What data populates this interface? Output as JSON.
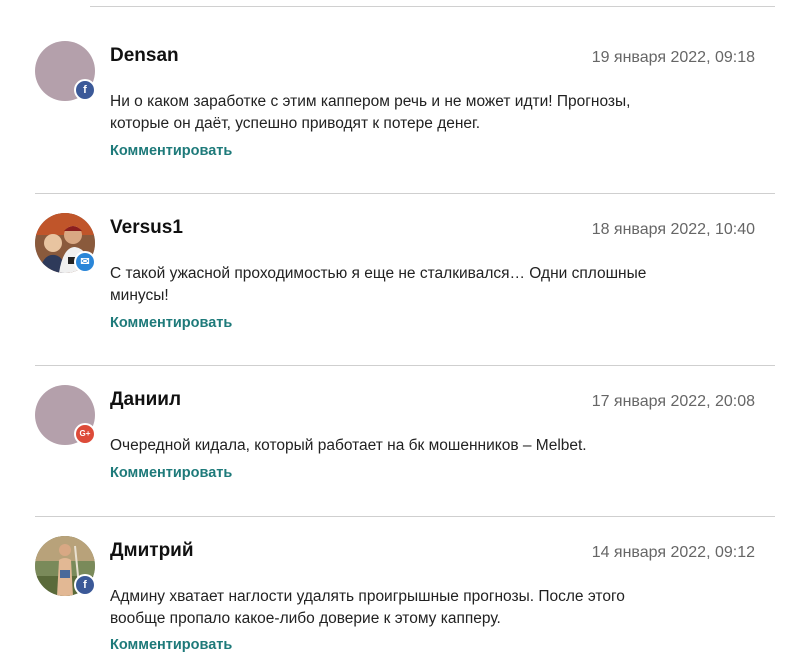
{
  "comments": [
    {
      "author": "Densan",
      "date": "19 января 2022, 09:18",
      "text": "Ни о каком заработке с этим каппером речь и не может идти! Прогнозы, которые он даёт, успешно приводят к потере денег.",
      "reply_label": "Комментировать",
      "avatar": "placeholder-avatar",
      "network_icon": "facebook-icon",
      "network_glyph": "f"
    },
    {
      "author": "Versus1",
      "date": "18 января 2022, 10:40",
      "text": "С такой ужасной проходимостью я еще не сталкивался… Одни сплошные минусы!",
      "reply_label": "Комментировать",
      "avatar": "photo-avatar",
      "network_icon": "mail-icon",
      "network_glyph": "✉"
    },
    {
      "author": "Даниил",
      "date": "17 января 2022, 20:08",
      "text": "Очередной кидала, который работает на бк мошенников – Melbet.",
      "reply_label": "Комментировать",
      "avatar": "placeholder-avatar",
      "network_icon": "google-plus-icon",
      "network_glyph": "G+"
    },
    {
      "author": "Дмитрий",
      "date": "14 января 2022, 09:12",
      "text": "Админу хватает наглости удалять проигрышные прогнозы. После этого вообще пропало какое-либо доверие к этому капперу.",
      "reply_label": "Комментировать",
      "avatar": "photo-avatar",
      "network_icon": "facebook-icon",
      "network_glyph": "f"
    }
  ],
  "colors": {
    "accent_link": "#1e7a7a",
    "placeholder_avatar": "#b4a0ab",
    "facebook": "#3b5998",
    "mail": "#2a86d8",
    "google_plus": "#dd4b39"
  }
}
